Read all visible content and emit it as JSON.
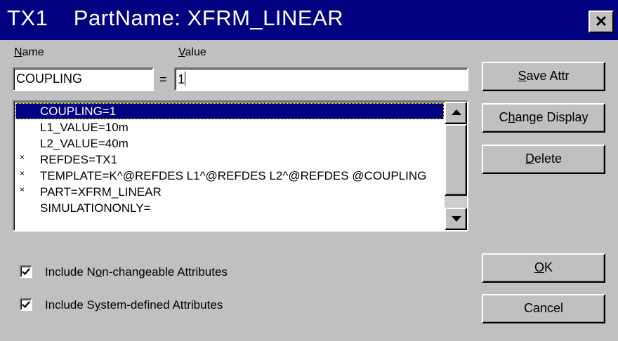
{
  "window": {
    "title": "TX1    PartName: XFRM_LINEAR",
    "close_glyph": "✕"
  },
  "labels": {
    "name_label_first": "N",
    "name_label_rest": "ame",
    "value_label_first": "V",
    "value_label_rest": "alue",
    "equals": "="
  },
  "fields": {
    "name_value": "COUPLING",
    "value_value": "1"
  },
  "attributes": [
    {
      "mark": "",
      "text": "COUPLING=1",
      "selected": true
    },
    {
      "mark": "",
      "text": "L1_VALUE=10m",
      "selected": false
    },
    {
      "mark": "",
      "text": "L2_VALUE=40m",
      "selected": false
    },
    {
      "mark": "×",
      "text": "REFDES=TX1",
      "selected": false
    },
    {
      "mark": "×",
      "text": "TEMPLATE=K^@REFDES L1^@REFDES L2^@REFDES @COUPLING",
      "selected": false
    },
    {
      "mark": "×",
      "text": "PART=XFRM_LINEAR",
      "selected": false
    },
    {
      "mark": "",
      "text": "SIMULATIONONLY=",
      "selected": false
    }
  ],
  "buttons": {
    "save_attr_pre": "",
    "save_attr_u": "S",
    "save_attr_post": "ave Attr",
    "change_display_pre": "C",
    "change_display_u": "h",
    "change_display_post": "ange Display",
    "delete_pre": "",
    "delete_u": "D",
    "delete_post": "elete",
    "ok_pre": "",
    "ok_u": "O",
    "ok_post": "K",
    "cancel": "Cancel"
  },
  "checkboxes": {
    "non_changeable_pre": "Include N",
    "non_changeable_u": "o",
    "non_changeable_post": "n-changeable Attributes",
    "non_changeable_checked": true,
    "system_defined_pre": "Include S",
    "system_defined_u": "y",
    "system_defined_post": "stem-defined Attributes",
    "system_defined_checked": true
  }
}
